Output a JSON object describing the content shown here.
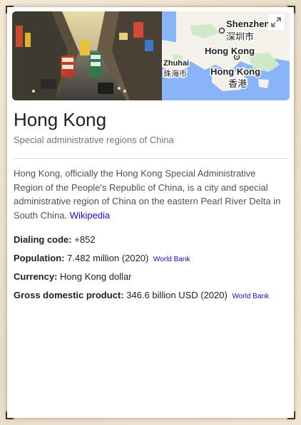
{
  "map": {
    "labels": {
      "shenzhen_en": "Shenzhen",
      "shenzhen_zh": "深圳市",
      "hk_en": "Hong Kong",
      "hk_zh": "香港",
      "zhuhai_en": "Zhuhai",
      "zhuhai_zh": "珠海市"
    },
    "colors": {
      "water": "#8ab4f8",
      "land": "#f4f1ea",
      "park": "#cfe8c7"
    }
  },
  "entity": {
    "title": "Hong Kong",
    "subtitle": "Special administrative regions of China"
  },
  "description": {
    "text": "Hong Kong, officially the Hong Kong Special Administrative Region of the People's Republic of China, is a city and special administrative region of China on the eastern Pearl River Delta in South China.",
    "source_link": "Wikipedia"
  },
  "facts": [
    {
      "label": "Dialing code:",
      "value": "+852",
      "source": ""
    },
    {
      "label": "Population:",
      "value": "7.482 million (2020)",
      "source": "World Bank"
    },
    {
      "label": "Currency:",
      "value": "Hong Kong dollar",
      "source": ""
    },
    {
      "label": "Gross domestic product:",
      "value": "346.6 billion USD (2020)",
      "source": "World Bank"
    }
  ],
  "icons": {
    "expand": "expand-icon"
  },
  "colors": {
    "link": "#1a0dab",
    "title": "#202124",
    "muted": "#70757a",
    "frame_bg": "#efe3d0"
  }
}
